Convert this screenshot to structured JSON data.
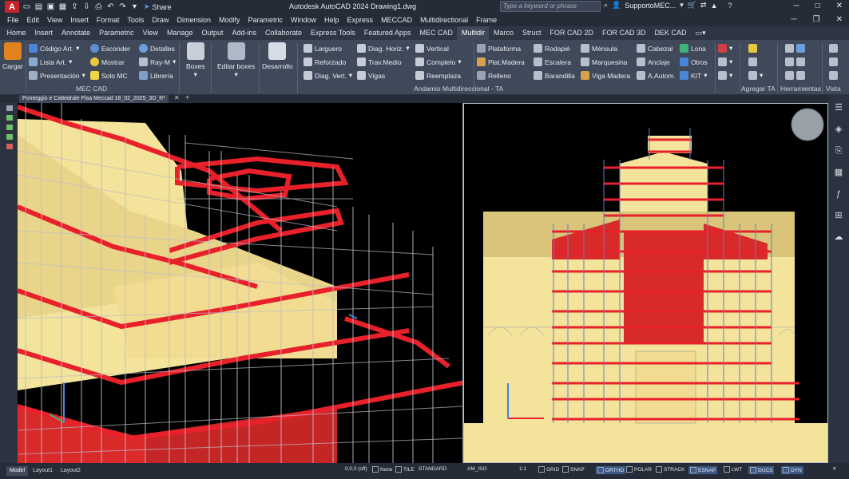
{
  "window": {
    "title": "Autodesk AutoCAD 2024   Drawing1.dwg",
    "logo": "A",
    "share": "Share"
  },
  "search": {
    "placeholder": "Type a keyword or phrase"
  },
  "account": {
    "user": "SupportoMEC..."
  },
  "menu": [
    "File",
    "Edit",
    "View",
    "Insert",
    "Format",
    "Tools",
    "Draw",
    "Dimension",
    "Modify",
    "Parametric",
    "Window",
    "Help",
    "Express",
    "MECCAD",
    "Multidirectional",
    "Frame"
  ],
  "tabs": [
    "Home",
    "Insert",
    "Annotate",
    "Parametric",
    "View",
    "Manage",
    "Output",
    "Add-ins",
    "Collaborate",
    "Express Tools",
    "Featured Apps",
    "MEC CAD",
    "Multidir",
    "Marco",
    "Struct",
    "FOR CAD 2D",
    "FOR CAD 3D",
    "DEK CAD"
  ],
  "active_tab": "Multidir",
  "ribbon": {
    "cargar": "Cargar",
    "mec_cad": {
      "items": [
        "Código Art.",
        "Lista Art.",
        "Presentación",
        "Esconder",
        "Mostrar",
        "Solo MC",
        "Detalles",
        "Ray-M",
        "Librería"
      ],
      "label": "MEC CAD"
    },
    "boxes": "Boxes",
    "editar_boxes": "Editar boxes",
    "desarrollo": "Desarrollo",
    "multidir": {
      "items": [
        "Larguero",
        "Reforzado",
        "Diag. Vert.",
        "Diag. Horiz.",
        "Trav.Medio",
        "Vigas",
        "Vertical",
        "Completo",
        "Reemplaza",
        "Plataforma",
        "Plat.Madera",
        "Relleno",
        "Rodapié",
        "Escalera",
        "Barandilla",
        "Ménsula",
        "Marquesina",
        "Viga Madera",
        "Cabezal",
        "Anclaje",
        "A.Autom.",
        "Lona",
        "Otros",
        "KIT"
      ],
      "label": "Andamio Multidireccional - TA"
    },
    "agregar_ta": "Agregar TA",
    "herramientas": "Herramientas",
    "vista": "Vista"
  },
  "file_tab": "Ponteggio e Cattedrale Pisa Meccad 18_02_2025_3D_R*",
  "statusbar": {
    "tabs": [
      "Model",
      "Layout1",
      "Layout2"
    ],
    "coords": "0,0,0 (off)",
    "items": [
      "None",
      "TILE",
      "STANDARD",
      "AM_ISO",
      "1:1",
      "GRID",
      "SNAP",
      "ORTHO",
      "POLAR",
      "STRACK",
      "ESNAP",
      "LWT",
      "DUCS",
      "DYN"
    ]
  },
  "colors": {
    "accent": "#e8202a",
    "facade": "#f4e39a",
    "scaffold": "#b9bec8"
  }
}
